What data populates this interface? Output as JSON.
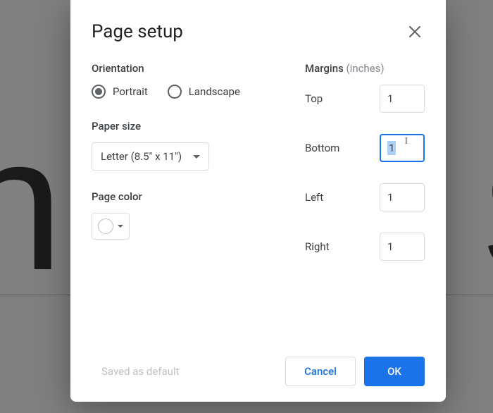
{
  "dialog": {
    "title": "Page setup",
    "orientation": {
      "label": "Orientation",
      "options": {
        "portrait": "Portrait",
        "landscape": "Landscape"
      },
      "selected": "portrait"
    },
    "paper_size": {
      "label": "Paper size",
      "value": "Letter (8.5\" x 11\")"
    },
    "page_color": {
      "label": "Page color",
      "value": "#ffffff"
    },
    "margins": {
      "label": "Margins",
      "unit_label": "(inches)",
      "top": {
        "label": "Top",
        "value": "1"
      },
      "bottom": {
        "label": "Bottom",
        "value": "1",
        "focused": true
      },
      "left": {
        "label": "Left",
        "value": "1"
      },
      "right": {
        "label": "Right",
        "value": "1"
      }
    },
    "footer": {
      "saved_default": "Saved as default",
      "cancel": "Cancel",
      "ok": "OK"
    }
  }
}
